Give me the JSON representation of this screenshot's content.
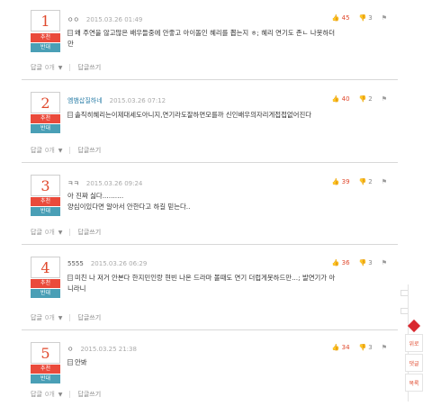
{
  "comments": [
    {
      "rank": "1",
      "up_label": "추천",
      "down_label": "반대",
      "nickname": "ㅇㅇ",
      "time": "2015.03.26 01:49",
      "body_lines": [
        "왜 주연을 않고많은 배우들중에 안좋고 아이돌인 혜리를 뽑는지 ㅎ; 혜리 연기도 존ㄴ 나못하더",
        "만"
      ],
      "likes": "45",
      "dislikes": "3",
      "reply_label": "답글",
      "reply_count": "0개",
      "write_reply_label": "답글쓰기"
    },
    {
      "rank": "2",
      "up_label": "추천",
      "down_label": "반대",
      "nickname": "옘뱀삽질하네",
      "time": "2015.03.26 07:12",
      "body_lines": [
        "솔직히혜리는이제대세도아니지,연기라도잘하면모를까 신인배우의자리게접접없어진다"
      ],
      "likes": "40",
      "dislikes": "2",
      "reply_label": "답글",
      "reply_count": "0개",
      "write_reply_label": "답글쓰기"
    },
    {
      "rank": "3",
      "up_label": "추천",
      "down_label": "반대",
      "nickname": "ㅋㅋ",
      "time": "2015.03.26 09:24",
      "body_lines": [
        "아 진짜 싫다..........",
        "양심이있다면 알아서 안한다고 하길 믿는다.."
      ],
      "likes": "39",
      "dislikes": "2",
      "reply_label": "답글",
      "reply_count": "0개",
      "write_reply_label": "답글쓰기"
    },
    {
      "rank": "4",
      "up_label": "추천",
      "down_label": "반대",
      "nickname": "5555",
      "time": "2015.03.26 06:29",
      "body_lines": [
        "미친 나 저거 안본다 한지민인랑 현빈 나온 드라마 볼때도 연기 더럽게못하드만...; 발연기가 아",
        "니라니"
      ],
      "likes": "36",
      "dislikes": "3",
      "reply_label": "답글",
      "reply_count": "0개",
      "write_reply_label": "답글쓰기"
    },
    {
      "rank": "5",
      "up_label": "추천",
      "down_label": "반대",
      "nickname": "ㅇ",
      "time": "2015.03.25 21:38",
      "body_lines": [
        "안봐"
      ],
      "likes": "34",
      "dislikes": "3",
      "reply_label": "답글",
      "reply_count": "0개",
      "write_reply_label": "답글쓰기"
    }
  ],
  "side_nav": {
    "top_label": "위로",
    "comments_label": "댓글",
    "list_label": "목록"
  },
  "colors": {
    "accent_red": "#e0492d",
    "up_button": "#ea4a3b",
    "down_button": "#4a9fb6",
    "side_cube": "#d9282f"
  }
}
